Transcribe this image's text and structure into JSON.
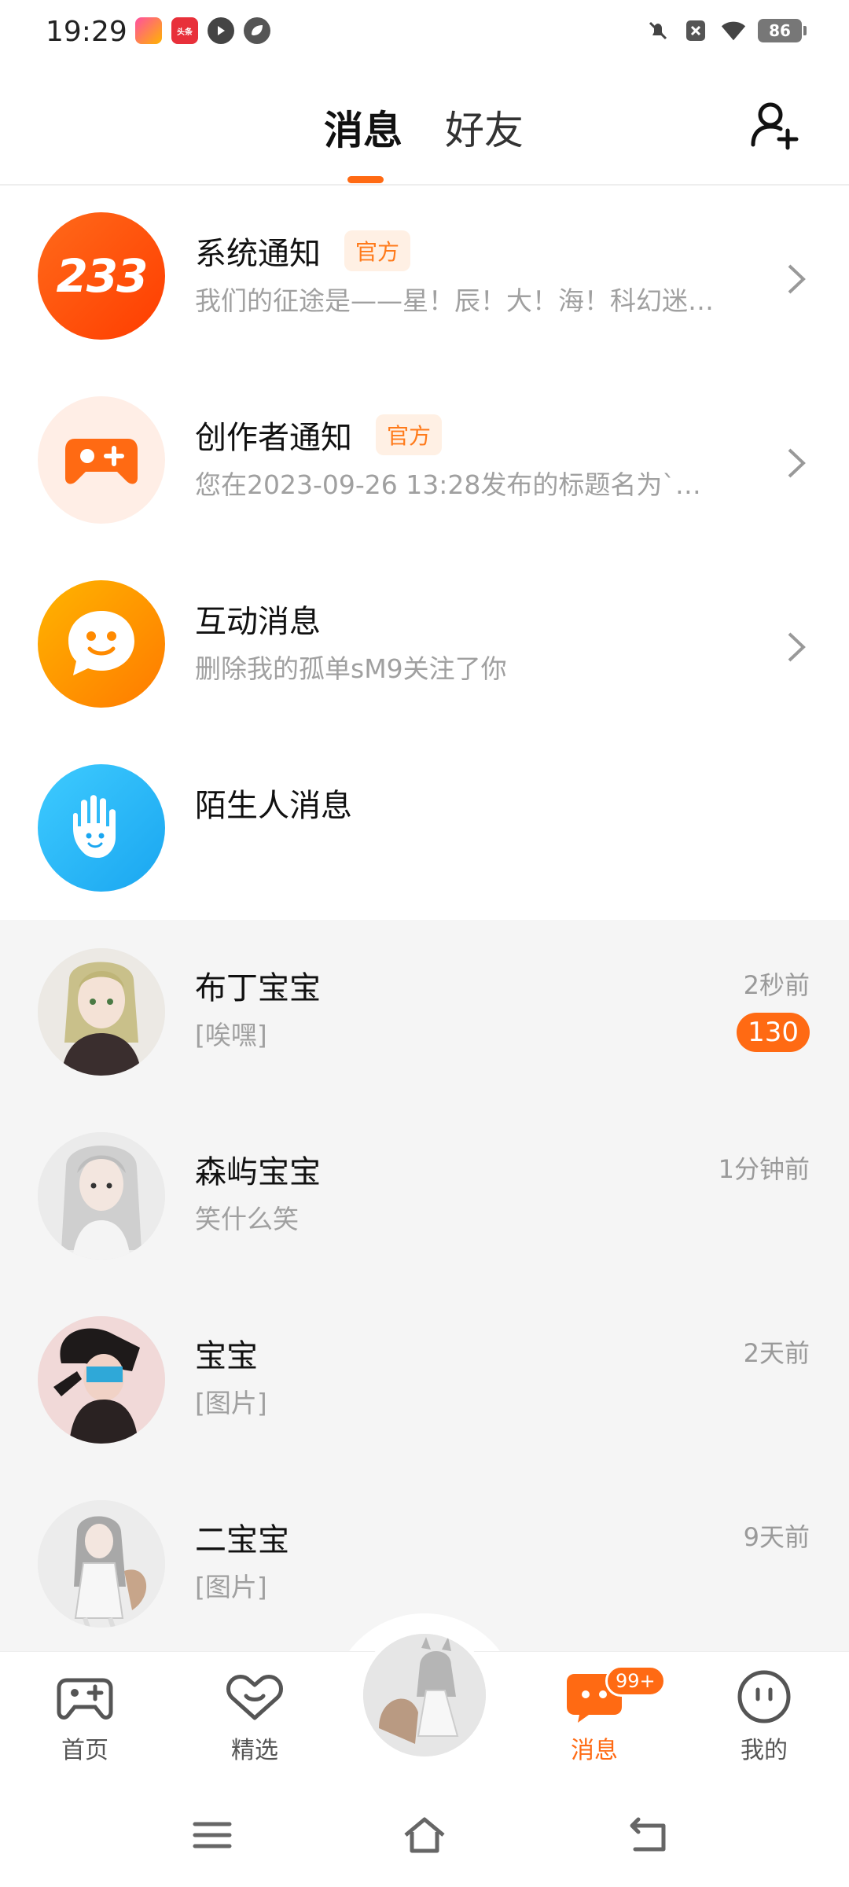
{
  "status_bar": {
    "time": "19:29",
    "battery": "86",
    "icons": [
      "mute-icon",
      "close-box-icon",
      "wifi-icon"
    ],
    "app_icons": [
      "app-icon-1",
      "toutiao-icon",
      "play-icon",
      "leaf-icon"
    ],
    "toutiao_label": "头条"
  },
  "header": {
    "tabs": [
      {
        "label": "消息",
        "active": true
      },
      {
        "label": "好友",
        "active": false
      }
    ],
    "accent": "#ff6a13"
  },
  "system_rows": [
    {
      "title": "系统通知",
      "badge": "官方",
      "subtitle": "我们的征途是——星！辰！大！海！科幻迷…",
      "icon": "233-logo",
      "logo_text": "233"
    },
    {
      "title": "创作者通知",
      "badge": "官方",
      "subtitle": "您在2023-09-26 13:28发布的标题名为`…",
      "icon": "gamepad-icon"
    },
    {
      "title": "互动消息",
      "subtitle": "删除我的孤单sM9关注了你",
      "icon": "chat-smile-icon"
    },
    {
      "title": "陌生人消息",
      "icon": "hand-wave-icon"
    }
  ],
  "chats": [
    {
      "name": "布丁宝宝",
      "message": "[唉嘿]",
      "time": "2秒前",
      "unread": "130"
    },
    {
      "name": "森屿宝宝",
      "message": "笑什么笑",
      "time": "1分钟前"
    },
    {
      "name": "宝宝",
      "message": "[图片]",
      "time": "2天前"
    },
    {
      "name": "二宝宝",
      "message": "[图片]",
      "time": "9天前"
    }
  ],
  "bottom_nav": {
    "items": [
      {
        "label": "首页",
        "icon": "gamepad-nav-icon"
      },
      {
        "label": "精选",
        "icon": "heart-box-icon"
      },
      {
        "label": "消息",
        "icon": "message-nav-icon",
        "active": true,
        "badge": "99+"
      },
      {
        "label": "我的",
        "icon": "face-icon"
      }
    ]
  }
}
